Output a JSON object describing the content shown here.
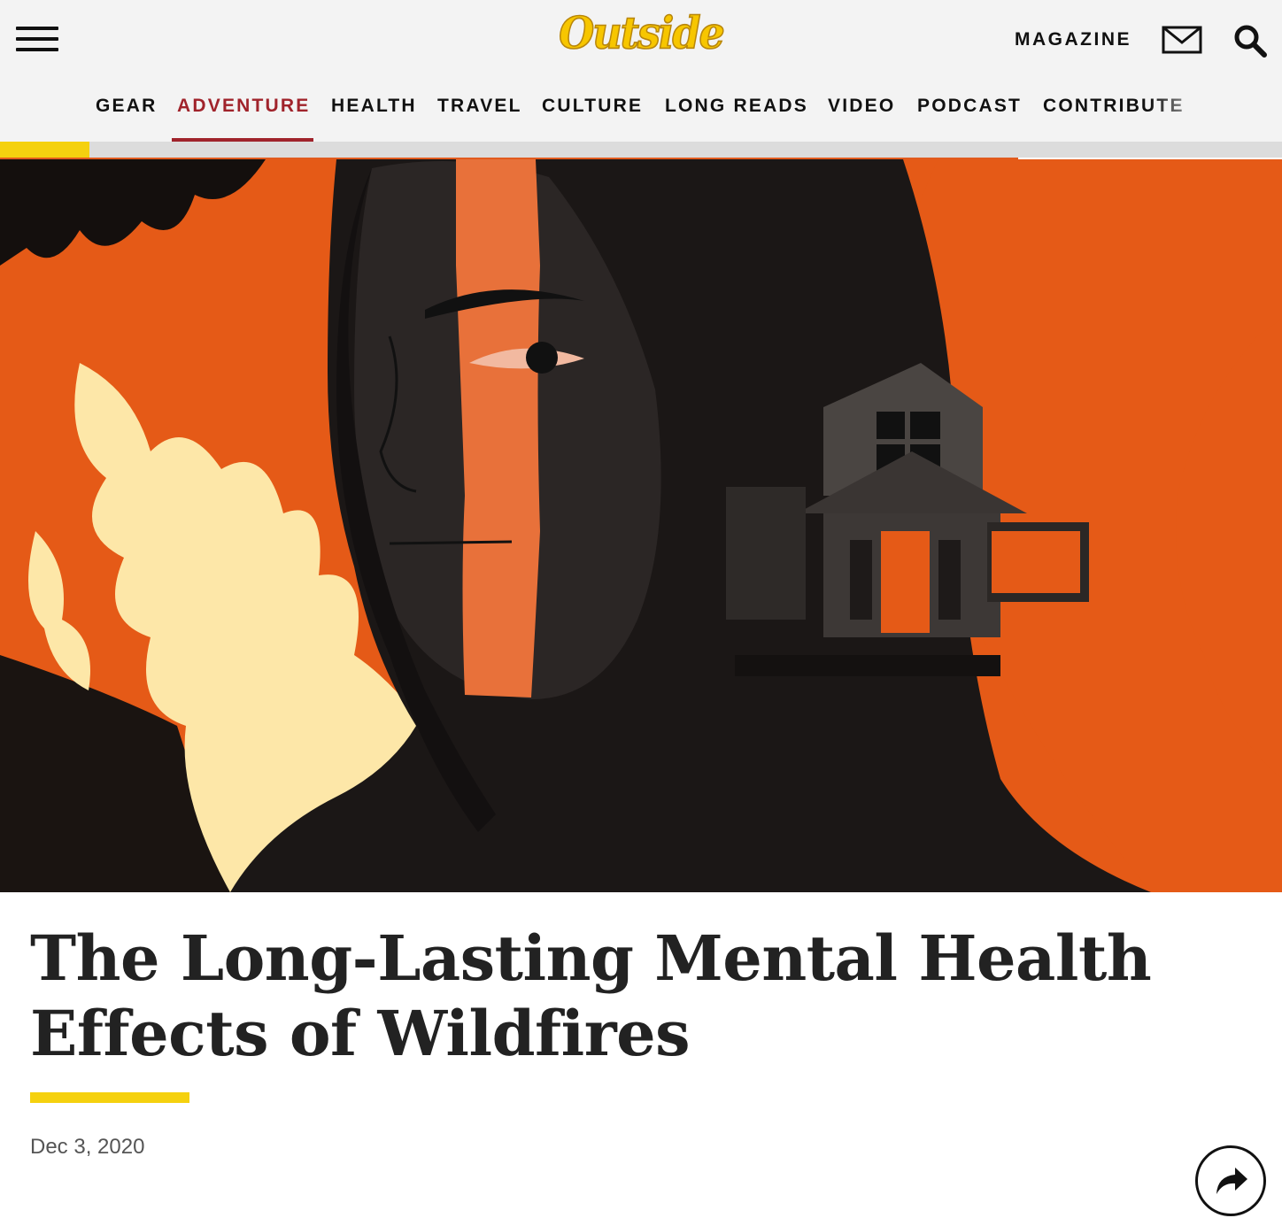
{
  "header": {
    "brand": "Outside",
    "menu_icon": "hamburger-menu-icon",
    "magazine_label": "MAGAZINE",
    "mail_icon": "mail-icon",
    "search_icon": "search-icon"
  },
  "nav": {
    "items": [
      {
        "label": "GEAR",
        "active": false
      },
      {
        "label": "ADVENTURE",
        "active": true
      },
      {
        "label": "HEALTH",
        "active": false
      },
      {
        "label": "TRAVEL",
        "active": false
      },
      {
        "label": "CULTURE",
        "active": false
      },
      {
        "label": "LONG READS",
        "active": false
      },
      {
        "label": "VIDEO",
        "active": false
      },
      {
        "label": "PODCAST",
        "active": false
      },
      {
        "label": "CONTRIBUTE",
        "active": false
      }
    ]
  },
  "reading_progress": 0.07,
  "article": {
    "title": "The Long-Lasting Mental Health Effects of Wildfires",
    "date": "Dec 3, 2020",
    "share_icon": "share-arrow-icon"
  },
  "colors": {
    "accent_yellow": "#f5d10f",
    "active_nav": "#a0232b",
    "flame_orange": "#e55a17",
    "flame_light": "#fde7a8"
  }
}
